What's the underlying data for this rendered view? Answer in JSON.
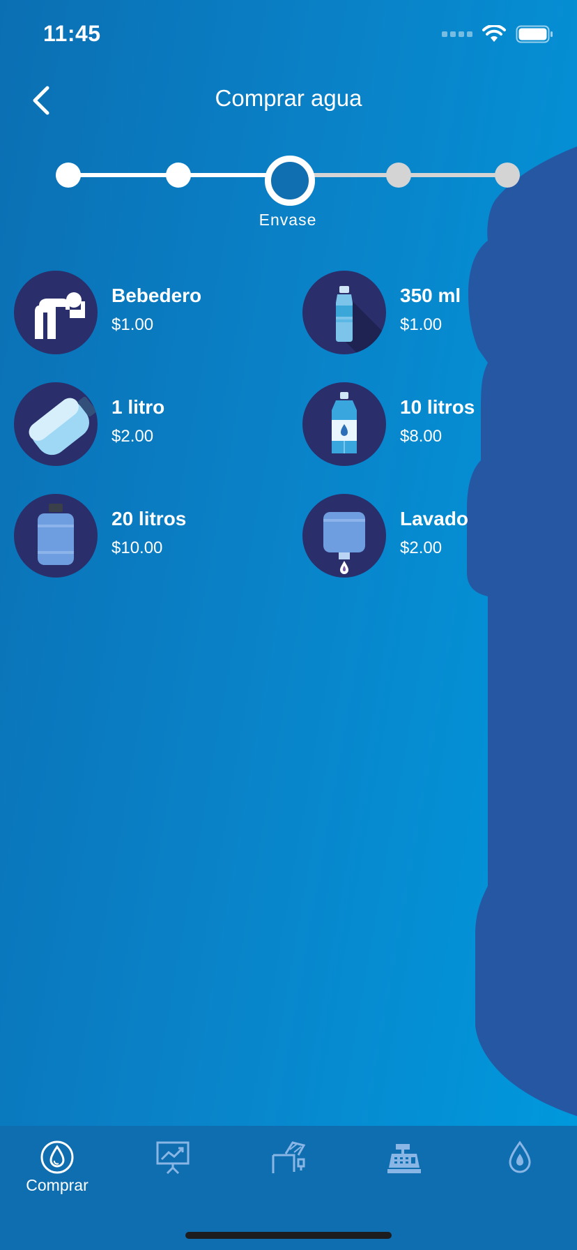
{
  "status_bar": {
    "time": "11:45"
  },
  "nav": {
    "title": "Comprar agua"
  },
  "stepper": {
    "current_label": "Envase",
    "total_steps": 5,
    "current_step": 3
  },
  "products": [
    {
      "name": "Bebedero",
      "price": "$1.00",
      "icon": "drinking-fountain-icon"
    },
    {
      "name": "350 ml",
      "price": "$1.00",
      "icon": "small-bottle-icon"
    },
    {
      "name": "1 litro",
      "price": "$2.00",
      "icon": "tilted-bottle-icon"
    },
    {
      "name": "10 litros",
      "price": "$8.00",
      "icon": "water-bottle-drop-icon"
    },
    {
      "name": "20 litros",
      "price": "$10.00",
      "icon": "water-jug-icon"
    },
    {
      "name": "Lavado",
      "price": "$2.00",
      "icon": "jug-wash-icon"
    }
  ],
  "tab_bar": {
    "tabs": [
      {
        "label": "Comprar",
        "icon": "water-drop-circle-icon",
        "active": true
      },
      {
        "label": "",
        "icon": "presentation-chart-icon",
        "active": false
      },
      {
        "label": "",
        "icon": "dispenser-machine-icon",
        "active": false
      },
      {
        "label": "",
        "icon": "cash-register-icon",
        "active": false
      },
      {
        "label": "",
        "icon": "water-drop-icon",
        "active": false
      }
    ]
  },
  "colors": {
    "background": "#0a82c8",
    "jug_silhouette": "#2557a3",
    "icon_circle": "#2a2f6b",
    "tab_bar": "#0f6eb0",
    "inactive_step": "#d4d4d4"
  }
}
